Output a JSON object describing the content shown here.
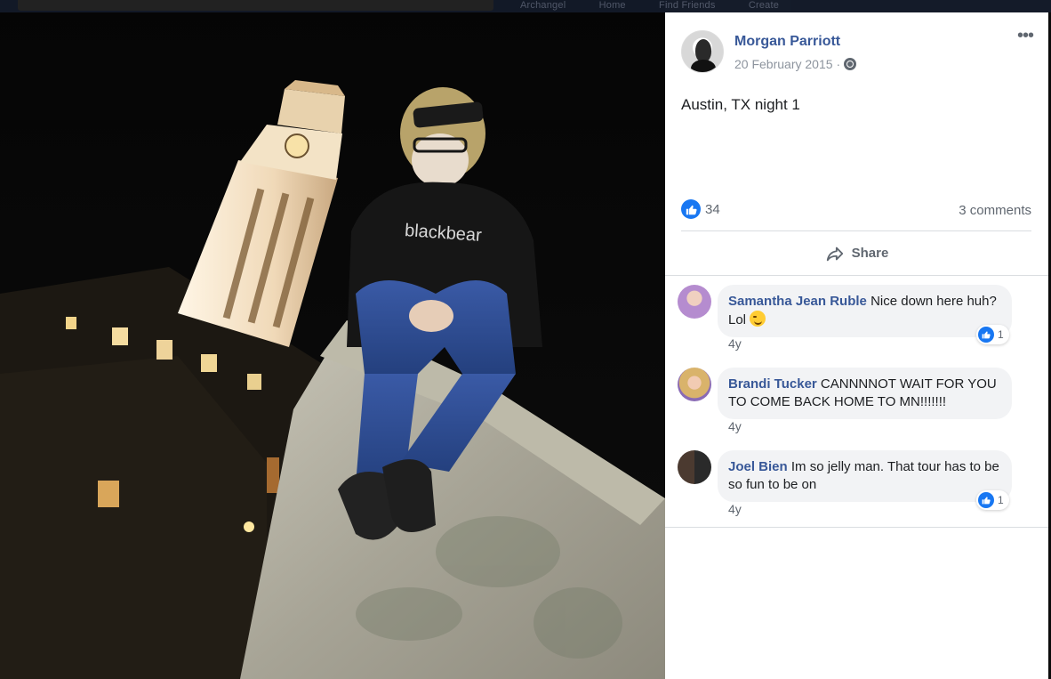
{
  "topbar": {
    "nav_items": [
      "Archangel",
      "Home",
      "Find Friends",
      "Create"
    ]
  },
  "photo": {
    "shirt_text": "blackbear"
  },
  "post": {
    "author": "Morgan Parriott",
    "date": "20 February 2015",
    "date_separator": "·",
    "privacy_icon": "globe-icon",
    "more_label": "•••",
    "caption": "Austin, TX night 1",
    "like_count": "34",
    "comments_count": "3 comments",
    "share_label": "Share"
  },
  "comments": [
    {
      "name": "Samantha Jean Ruble",
      "text": "Nice down here huh? Lol",
      "emoji": "winking-face",
      "time": "4y",
      "reactions": "1",
      "avatar_color": "#b58ccf"
    },
    {
      "name": "Brandi Tucker",
      "text": "CANNNNOT WAIT FOR YOU TO COME BACK HOME TO MN!!!!!!!",
      "time": "4y",
      "avatar_color": "#d9b36b"
    },
    {
      "name": "Joel Bien",
      "text": "Im so jelly man. That tour has to be so fun to be on",
      "time": "4y",
      "reactions": "1",
      "avatar_color": "#3c3c3c"
    }
  ],
  "colors": {
    "link": "#385898",
    "like_blue": "#1877f2",
    "muted": "#606770"
  }
}
